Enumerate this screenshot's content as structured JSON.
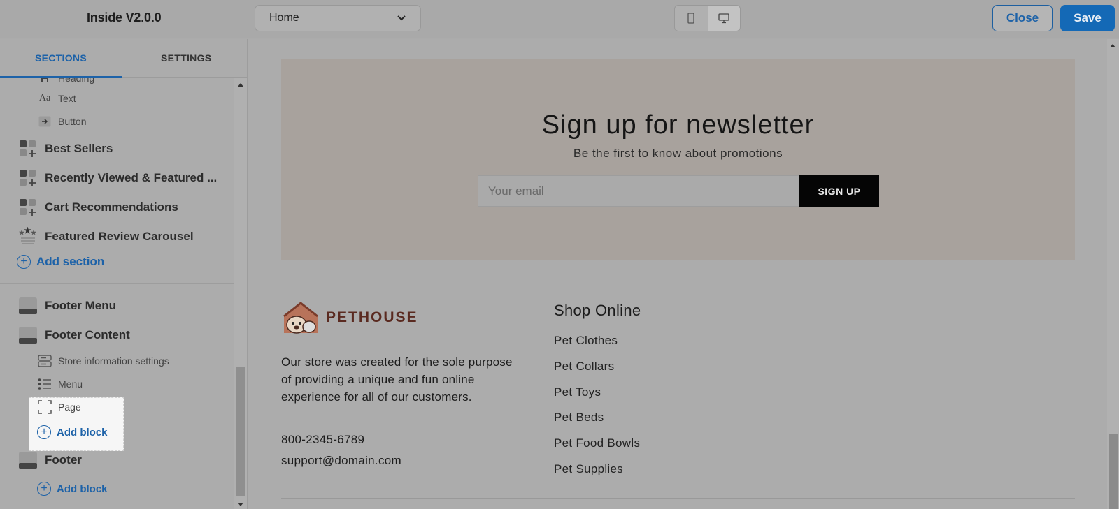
{
  "header": {
    "app_title": "Inside V2.0.0",
    "page_select_value": "Home",
    "close_label": "Close",
    "save_label": "Save",
    "devices": [
      "mobile-icon",
      "desktop-icon"
    ],
    "active_device": "desktop"
  },
  "sidebar": {
    "tabs": [
      "SECTIONS",
      "SETTINGS"
    ],
    "active_tab": "SECTIONS",
    "tree": {
      "partial_item": "Heading",
      "sub_items_top": [
        {
          "icon": "text-icon",
          "label": "Text"
        },
        {
          "icon": "button-icon",
          "label": "Button"
        }
      ],
      "sections": [
        {
          "icon": "section-add-icon",
          "label": "Best Sellers"
        },
        {
          "icon": "section-add-icon",
          "label": "Recently Viewed & Featured ..."
        },
        {
          "icon": "section-add-icon",
          "label": "Cart Recommendations"
        },
        {
          "icon": "stars-icon",
          "label": "Featured Review Carousel"
        }
      ],
      "add_section_label": "Add section",
      "footer_sections": [
        {
          "icon": "footer-icon",
          "label": "Footer Menu"
        },
        {
          "icon": "footer-icon",
          "label": "Footer Content"
        }
      ],
      "footer_content_blocks": [
        {
          "icon": "store-info-icon",
          "label": "Store information settings"
        },
        {
          "icon": "menu-list-icon",
          "label": "Menu"
        },
        {
          "icon": "page-icon",
          "label": "Page"
        }
      ],
      "add_block_label": "Add block",
      "footer_label": "Footer",
      "footer_add_block_label": "Add block"
    }
  },
  "preview": {
    "newsletter": {
      "title": "Sign up for newsletter",
      "subtitle": "Be the first to know about promotions",
      "email_placeholder": "Your email",
      "button_label": "SIGN UP"
    },
    "footer": {
      "brand": "PETHOUSE",
      "about": "Our store was created for the sole purpose of providing a unique and fun online experience for all of our customers.",
      "phone": "800-2345-6789",
      "email": "support@domain.com",
      "shop_heading": "Shop Online",
      "shop_links": [
        "Pet Clothes",
        "Pet Collars",
        "Pet Toys",
        "Pet Beds",
        "Pet Food Bowls",
        "Pet Supplies"
      ]
    }
  },
  "colors": {
    "accent": "#1d62a8",
    "save_bg": "#1469b6",
    "newsletter_bg": "#a8a29d",
    "signup_bg": "#050505"
  }
}
